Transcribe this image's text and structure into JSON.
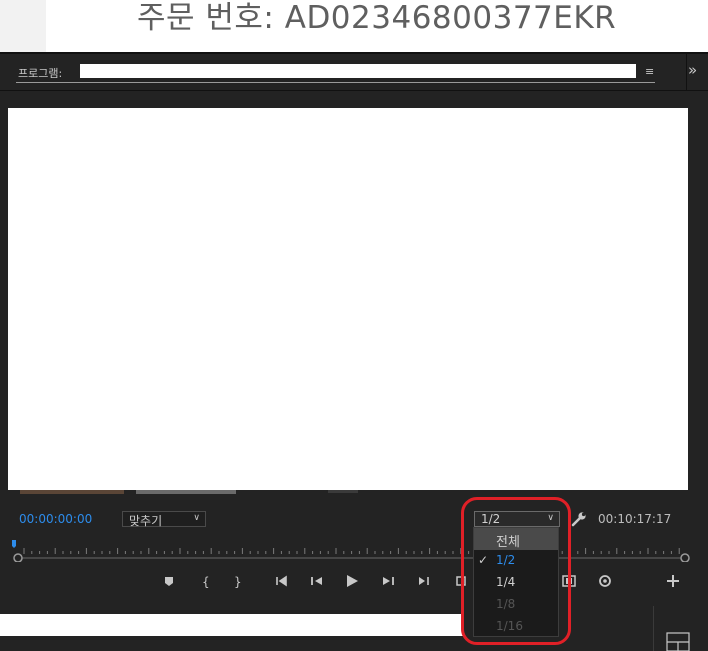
{
  "background_doc": {
    "order_text": "주문 번호: AD02346800377EKR"
  },
  "panel": {
    "title": "프로그램:",
    "menu_icon": "≡",
    "overflow_icon": "»"
  },
  "controls": {
    "timecode_current": "00:00:00:00",
    "zoom_value": "맞추기",
    "resolution_value": "1/2",
    "timecode_duration": "00:10:17:17"
  },
  "resolution_dropdown": {
    "options": [
      {
        "label": "전체",
        "state": "header"
      },
      {
        "label": "1/2",
        "state": "selected"
      },
      {
        "label": "1/4",
        "state": "normal"
      },
      {
        "label": "1/8",
        "state": "disabled"
      },
      {
        "label": "1/16",
        "state": "disabled"
      }
    ]
  },
  "colors": {
    "accent_blue": "#2d8ceb",
    "panel_bg": "#232323",
    "annotation_red": "#e02027"
  },
  "icons": {
    "wrench": "wrench-icon",
    "marker": "add-marker-icon",
    "in": "mark-in-icon",
    "out": "mark-out-icon",
    "goto_in": "go-to-in-icon",
    "step_back": "step-back-icon",
    "play": "play-icon",
    "step_forward": "step-forward-icon",
    "goto_out": "go-to-out-icon",
    "export_frame": "export-frame-icon",
    "loop": "loop-icon",
    "add": "plus-icon"
  }
}
